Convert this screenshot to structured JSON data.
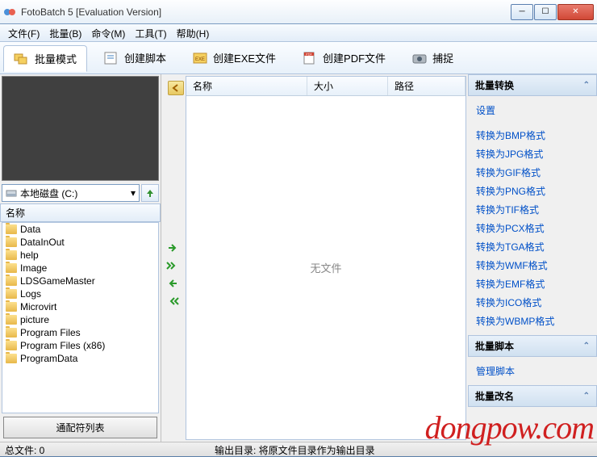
{
  "titlebar": {
    "title": "FotoBatch 5 [Evaluation Version]"
  },
  "menubar": {
    "items": [
      "文件(F)",
      "批量(B)",
      "命令(M)",
      "工具(T)",
      "帮助(H)"
    ]
  },
  "tabs": {
    "items": [
      {
        "label": "批量模式",
        "active": true
      },
      {
        "label": "创建脚本",
        "active": false
      },
      {
        "label": "创建EXE文件",
        "active": false
      },
      {
        "label": "创建PDF文件",
        "active": false
      },
      {
        "label": "捕捉",
        "active": false
      }
    ]
  },
  "drive": {
    "selected": "本地磁盘 (C:)"
  },
  "folder_header": "名称",
  "folders": [
    "Data",
    "DataInOut",
    "help",
    "Image",
    "LDSGameMaster",
    "Logs",
    "Microvirt",
    "picture",
    "Program Files",
    "Program Files (x86)",
    "ProgramData"
  ],
  "wildcard_button": "通配符列表",
  "list_columns": {
    "name": "名称",
    "size": "大小",
    "path": "路径"
  },
  "empty_text": "无文件",
  "right_sections": {
    "convert": {
      "title": "批量转换",
      "settings": "设置",
      "formats": [
        "转换为BMP格式",
        "转换为JPG格式",
        "转换为GIF格式",
        "转换为PNG格式",
        "转换为TIF格式",
        "转换为PCX格式",
        "转换为TGA格式",
        "转换为WMF格式",
        "转换为EMF格式",
        "转换为ICO格式",
        "转换为WBMP格式"
      ]
    },
    "script": {
      "title": "批量脚本",
      "manage": "管理脚本"
    },
    "rename": {
      "title": "批量改名"
    }
  },
  "statusbar": {
    "total_files": "总文件: 0",
    "output_dir": "输出目录: 将原文件目录作为输出目录"
  },
  "watermark": "dongpow.com"
}
